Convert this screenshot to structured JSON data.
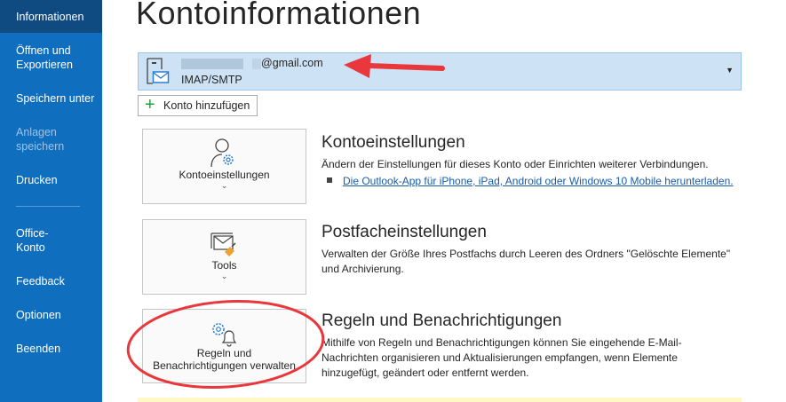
{
  "sidebar": {
    "items": [
      {
        "label": "Informationen",
        "selected": true
      },
      {
        "label": "Öffnen und",
        "label2": "Exportieren"
      },
      {
        "label": "Speichern unter"
      },
      {
        "label": "Anlagen",
        "label2": "speichern",
        "disabled": true
      },
      {
        "label": "Drucken"
      },
      {
        "label": "Office-",
        "label2": "Konto"
      },
      {
        "label": "Feedback"
      },
      {
        "label": "Optionen"
      },
      {
        "label": "Beenden"
      }
    ]
  },
  "main": {
    "title": "Kontoinformationen",
    "account": {
      "email": "@gmail.com",
      "type": "IMAP/SMTP"
    },
    "add_account": "Konto hinzufügen",
    "sections": [
      {
        "button": "Kontoeinstellungen",
        "heading": "Kontoeinstellungen",
        "text": "Ändern der Einstellungen für dieses Konto oder Einrichten weiterer Verbindungen.",
        "link": "Die Outlook-App für iPhone, iPad, Android oder Windows 10 Mobile herunterladen."
      },
      {
        "button": "Tools",
        "heading": "Postfacheinstellungen",
        "text": "Verwalten der Größe Ihres Postfachs durch Leeren des Ordners \"Gelöschte Elemente\" und Archivierung."
      },
      {
        "button": "Regeln und Benachrichtigungen verwalten",
        "button_l1": "Regeln und",
        "button_l2": "Benachrichtigungen verwalten",
        "heading": "Regeln und Benachrichtigungen",
        "text": "Mithilfe von Regeln und Benachrichtigungen können Sie eingehende E-Mail-Nachrichten organisieren und Aktualisierungen empfangen, wenn Elemente hinzugefügt, geändert oder entfernt werden."
      }
    ]
  },
  "colors": {
    "sidebar": "#106ebe",
    "selected": "#0f4a80",
    "annotation": "#e8383d"
  }
}
